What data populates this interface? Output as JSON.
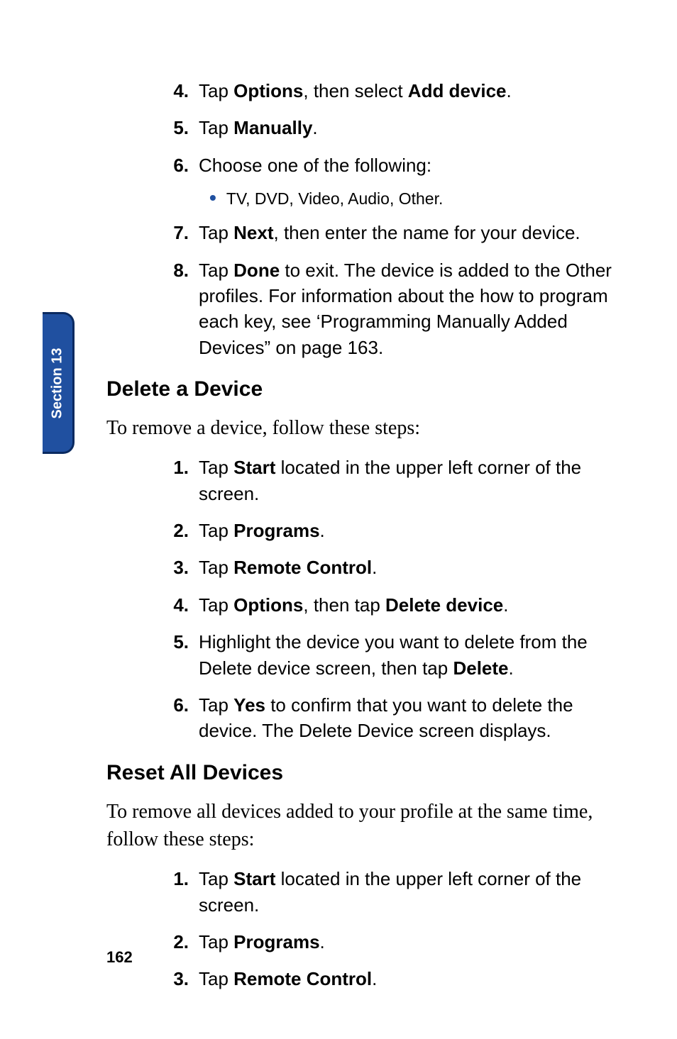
{
  "sideTab": "Section 13",
  "pageNumber": "162",
  "listA": [
    {
      "num": "4.",
      "parts": [
        "Tap ",
        {
          "b": "Options"
        },
        ", then select ",
        {
          "b": "Add device"
        },
        "."
      ]
    },
    {
      "num": "5.",
      "parts": [
        "Tap ",
        {
          "b": "Manually"
        },
        "."
      ]
    },
    {
      "num": "6.",
      "parts": [
        "Choose one of the following:"
      ]
    }
  ],
  "bulletA": "TV, DVD, Video, Audio, Other.",
  "listA2": [
    {
      "num": "7.",
      "parts": [
        "Tap ",
        {
          "b": "Next"
        },
        ", then enter the name for your device."
      ]
    },
    {
      "num": "8.",
      "parts": [
        "Tap ",
        {
          "b": "Done"
        },
        " to exit. The device is added to the Other profiles. For information about the how to program each key, see ‘Programming Manually Added Devices” on page 163."
      ]
    }
  ],
  "h2a": "Delete a Device",
  "introA": "To remove a device, follow these steps:",
  "listB": [
    {
      "num": "1.",
      "parts": [
        "Tap ",
        {
          "b": "Start"
        },
        " located in the upper left corner of the screen."
      ]
    },
    {
      "num": "2.",
      "parts": [
        "Tap ",
        {
          "b": "Programs"
        },
        "."
      ]
    },
    {
      "num": "3.",
      "parts": [
        "Tap ",
        {
          "b": "Remote Control"
        },
        "."
      ]
    },
    {
      "num": "4.",
      "parts": [
        "Tap ",
        {
          "b": "Options"
        },
        ", then tap ",
        {
          "b": "Delete device"
        },
        "."
      ]
    },
    {
      "num": "5.",
      "parts": [
        "Highlight the device you want to delete from the Delete device screen, then tap ",
        {
          "b": "Delete"
        },
        "."
      ]
    },
    {
      "num": "6.",
      "parts": [
        "Tap ",
        {
          "b": "Yes"
        },
        " to confirm that you want to delete the device. The Delete Device screen displays."
      ]
    }
  ],
  "h2b": "Reset All Devices",
  "introB": "To remove all devices added to your profile at the same time, follow these steps:",
  "listC": [
    {
      "num": "1.",
      "parts": [
        "Tap ",
        {
          "b": "Start"
        },
        " located in the upper left corner of the screen."
      ]
    },
    {
      "num": "2.",
      "parts": [
        "Tap ",
        {
          "b": "Programs"
        },
        "."
      ]
    },
    {
      "num": "3.",
      "parts": [
        "Tap ",
        {
          "b": "Remote Control"
        },
        "."
      ]
    }
  ]
}
